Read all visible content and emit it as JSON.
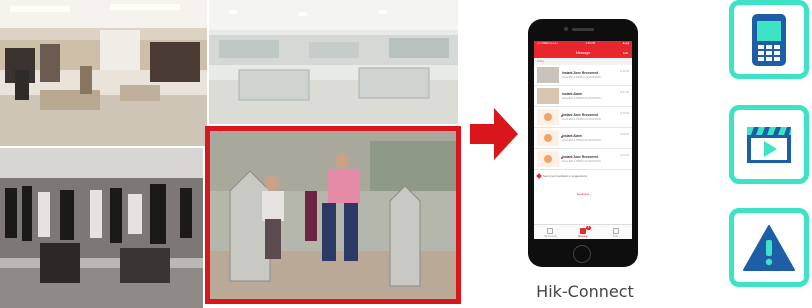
{
  "caption": "Hik-Connect",
  "colors": {
    "highlight": "#d9161c",
    "accent": "#3ee3c5",
    "icon_blue": "#1d5fa6",
    "app_red": "#e8262d"
  },
  "app": {
    "status_left": "•••• VIDEO  LL LL  •",
    "status_center": "4:45 PM",
    "status_right": "◆ ▮ ▮",
    "title": "Message",
    "edit": "Edit",
    "section_label": "Today",
    "messages": [
      {
        "title": "Instant Zone Recovered",
        "sub": "Zone-EW-1-PRSU1U-HIKVISION",
        "time": "11:48:28"
      },
      {
        "title": "Instant Alarm",
        "sub": "Zone-EW-1-PRSU1U-HIKVISION",
        "time": "11:47:00"
      },
      {
        "title": "Instant Zone Recovered",
        "sub": "Zone-EW-1-PRSU1U-HIKVISION",
        "time": "11:46:06"
      },
      {
        "title": "Instant Alarm",
        "sub": "Zone-EW-1-PRSU1U-HIKVISION",
        "time": "11:45:00"
      },
      {
        "title": "Instant Zone Recovered",
        "sub": "Zone-EW-1-PRSU1U-HIKVISION",
        "time": "11:44:00"
      }
    ],
    "feedback_prompt": "Send your feedback or suggestions",
    "feedback_button": "Feedback",
    "tabs": [
      {
        "label": "Hik-Connect"
      },
      {
        "label": "Message",
        "badge": "9"
      },
      {
        "label": "More"
      }
    ]
  },
  "icons": [
    "mobile-phone-icon",
    "video-playback-icon",
    "warning-icon"
  ]
}
